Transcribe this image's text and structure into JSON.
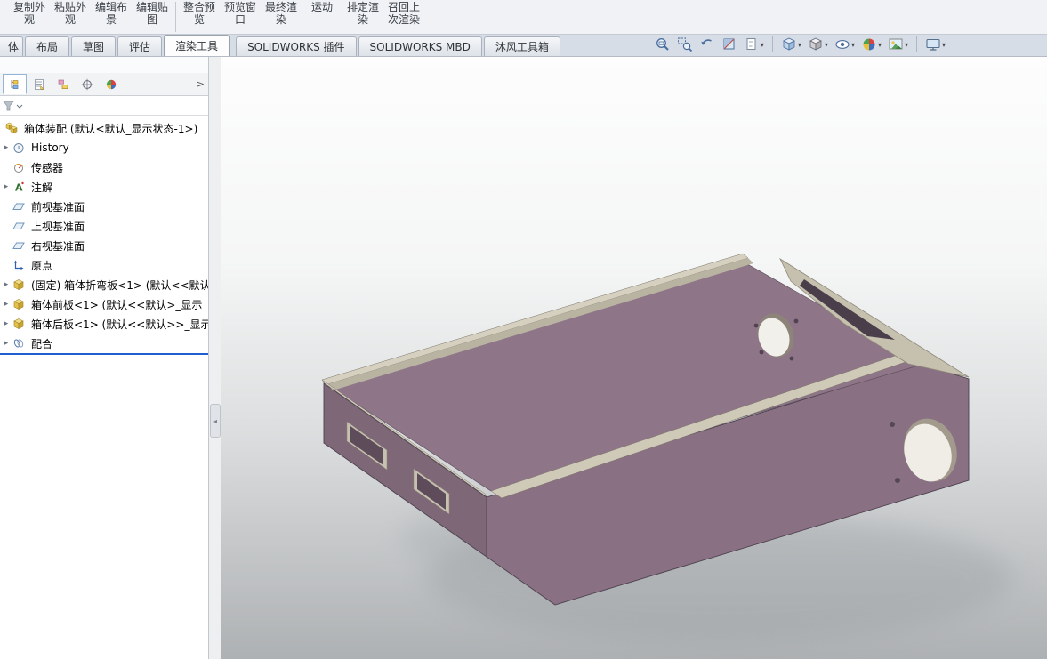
{
  "app": {
    "name": "SOLIDWORKS"
  },
  "ribbon": {
    "buttons": [
      {
        "label": "复制外观"
      },
      {
        "label": "粘贴外观"
      },
      {
        "label": "编辑布景"
      },
      {
        "label": "编辑贴图"
      },
      {
        "label": "整合预览"
      },
      {
        "label": "预览窗口"
      },
      {
        "label": "最终渲染"
      },
      {
        "label": "运动"
      },
      {
        "label": "排定渲染"
      },
      {
        "label": "召回上次渲染"
      }
    ]
  },
  "tabs": {
    "items": [
      {
        "label": "体",
        "active": false
      },
      {
        "label": "布局",
        "active": false
      },
      {
        "label": "草图",
        "active": false
      },
      {
        "label": "评估",
        "active": false
      },
      {
        "label": "渲染工具",
        "active": true
      },
      {
        "label": "SOLIDWORKS 插件",
        "active": false
      },
      {
        "label": "SOLIDWORKS MBD",
        "active": false
      },
      {
        "label": "沐风工具箱",
        "active": false
      }
    ]
  },
  "view_toolbar": {
    "icons": [
      "zoom-to-fit",
      "zoom-to-area",
      "previous-view",
      "section-view",
      "annotation-views",
      "view-orientation",
      "display-style",
      "hide-show-items",
      "edit-appearance",
      "apply-scene",
      "view-settings"
    ]
  },
  "panel_tabs": {
    "icons": [
      "featuremanager-tree",
      "propertymanager",
      "configurationmanager",
      "dimxpertmanager",
      "displaymanager"
    ],
    "overflow_label": ">"
  },
  "feature_tree": {
    "root": "箱体装配 (默认<默认_显示状态-1>)",
    "items": [
      {
        "label": "History"
      },
      {
        "label": "传感器"
      },
      {
        "label": "注解"
      },
      {
        "label": "前视基准面"
      },
      {
        "label": "上视基准面"
      },
      {
        "label": "右视基准面"
      },
      {
        "label": "原点"
      },
      {
        "label": "(固定) 箱体折弯板<1> (默认<<默认"
      },
      {
        "label": "箱体前板<1> (默认<<默认>_显示"
      },
      {
        "label": "箱体后板<1> (默认<<默认>>_显示"
      },
      {
        "label": "配合"
      }
    ]
  },
  "colors": {
    "model_purple": "#8e7588",
    "model_purple_dark": "#7e6878",
    "model_beige": "#cfc9b8",
    "selection_blue": "#1f5fd0",
    "viewport_top": "#fdfdfd",
    "viewport_bottom": "#aeb1b3"
  }
}
